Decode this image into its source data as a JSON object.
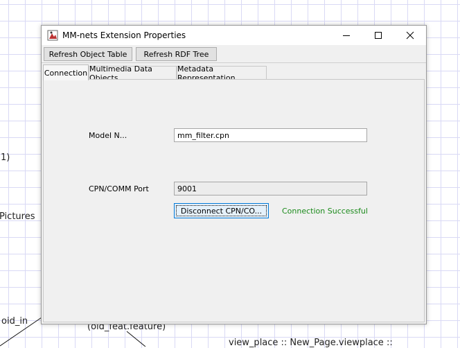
{
  "background": {
    "texts": [
      "1)",
      "Pictures",
      "oid_in",
      "(old_feat.feature)",
      "view_place :: New_Page.viewplace ::"
    ]
  },
  "window": {
    "title": "MM-nets Extension Properties",
    "controls": {
      "minimize": "minimize-icon",
      "maximize": "maximize-icon",
      "close": "close-icon"
    }
  },
  "toolbar": {
    "refresh_object_table": "Refresh Object Table",
    "refresh_rdf_tree": "Refresh RDF Tree"
  },
  "tabs": [
    {
      "label": "Connection",
      "active": true
    },
    {
      "label": "Multimedia Data Objects",
      "active": false
    },
    {
      "label": "Metadata Representation",
      "active": false
    }
  ],
  "connection": {
    "model_label": "Model N...",
    "model_value": "mm_filter.cpn",
    "port_label": "CPN/COMM Port",
    "port_value": "9001",
    "disconnect_button": "Disconnect CPN/CO...",
    "status_text": "Connection Successful",
    "status_color": "#1a8a1a"
  }
}
